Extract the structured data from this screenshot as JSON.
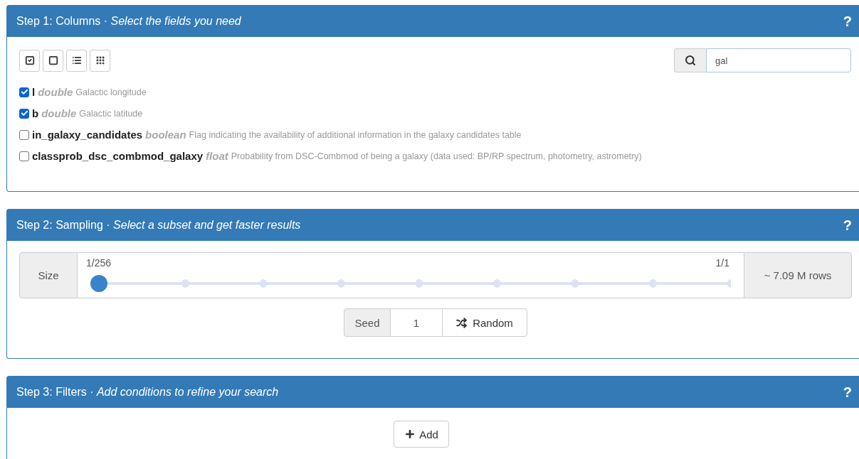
{
  "step1": {
    "header": "Step 1: Columns · *Select the fields you need*",
    "help": "?",
    "search": {
      "value": "gal"
    },
    "columns": [
      {
        "name": "l",
        "type": "double",
        "description": "Galactic longitude",
        "checked": true
      },
      {
        "name": "b",
        "type": "double",
        "description": "Galactic latitude",
        "checked": true
      },
      {
        "name": "in_galaxy_candidates",
        "type": "boolean",
        "description": "Flag indicating the availability of additional information in the galaxy candidates table",
        "checked": false
      },
      {
        "name": "classprob_dsc_combmod_galaxy",
        "type": "float",
        "description": "Probability from DSC-Combmod of being a galaxy (data used: BP/RP spectrum, photometry, astrometry)",
        "checked": false
      }
    ]
  },
  "step2": {
    "header": "Step 2: Sampling · *Select a subset and get faster results*",
    "help": "?",
    "size_label": "Size",
    "min_label": "1/256",
    "max_label": "1/1",
    "level": 0,
    "rows": "~ 7.09 M rows",
    "seed_label": "Seed",
    "seed": "1",
    "random": "Random"
  },
  "step3": {
    "header": "Step 3: Filters · *Add conditions to refine your search*",
    "help": "?",
    "add": "Add"
  }
}
